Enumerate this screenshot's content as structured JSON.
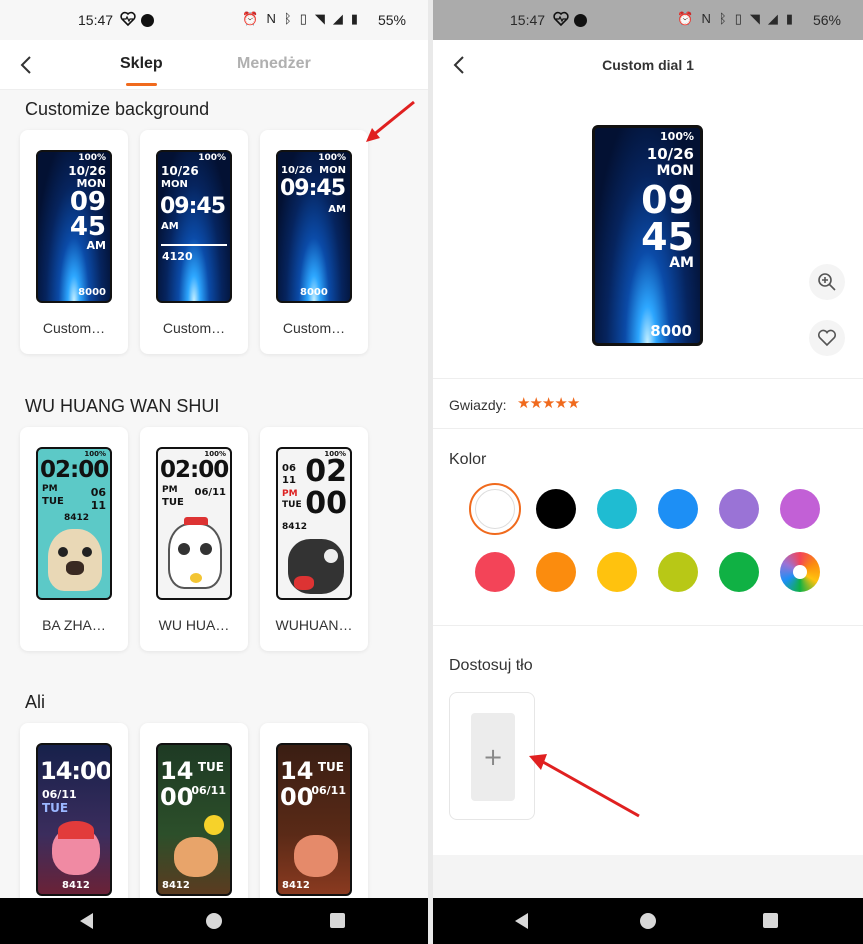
{
  "left": {
    "status": {
      "time": "15:47",
      "battery": "55%"
    },
    "tabs": {
      "active": "Sklep",
      "inactive": "Menedżer"
    },
    "sections": [
      {
        "title": "Customize background",
        "cards": [
          "Custom…",
          "Custom…",
          "Custom…"
        ]
      },
      {
        "title": "WU HUANG WAN SHUI",
        "cards": [
          "BA ZHA…",
          "WU HUA…",
          "WUHUAN…"
        ]
      },
      {
        "title": "Ali",
        "cards": [
          "",
          "",
          ""
        ]
      }
    ],
    "thumbs": {
      "c1": {
        "batt": "100%",
        "date": "10/26",
        "day": "MON",
        "h": "09",
        "m": "45",
        "ampm": "AM",
        "steps": "8000"
      },
      "c2": {
        "batt": "100%",
        "date": "10/26",
        "day": "MON",
        "time": "09:45",
        "ampm": "AM",
        "steps": "4120"
      },
      "c3": {
        "batt": "100%",
        "date": "10/26",
        "day": "MON",
        "time": "09:45",
        "ampm": "AM",
        "steps": "8000"
      },
      "w1": {
        "batt": "100%",
        "time": "02:00",
        "pm": "PM",
        "day": "TUE",
        "date1": "06",
        "date2": "11",
        "steps": "8412"
      },
      "w2": {
        "batt": "100%",
        "time": "02:00",
        "pm": "PM",
        "date": "06/11",
        "day": "TUE"
      },
      "w3": {
        "batt": "100%",
        "d1": "06",
        "d2": "11",
        "h": "02",
        "m": "00",
        "pm": "PM",
        "day": "TUE",
        "steps": "8412"
      },
      "a1": {
        "time": "14:00",
        "date": "06/11",
        "day": "TUE",
        "steps": "8412"
      },
      "a2": {
        "h": "14",
        "m": "00",
        "day": "TUE",
        "date": "06/11",
        "steps": "8412"
      },
      "a3": {
        "h": "14",
        "m": "00",
        "day": "TUE",
        "date": "06/11",
        "steps": "8412"
      }
    }
  },
  "right": {
    "status": {
      "time": "15:47",
      "battery": "56%"
    },
    "title": "Custom dial 1",
    "preview": {
      "batt": "100%",
      "date": "10/26",
      "day": "MON",
      "h": "09",
      "m": "45",
      "ampm": "AM",
      "steps": "8000"
    },
    "stars_label": "Gwiazdy:",
    "stars_value": 5,
    "color_label": "Kolor",
    "colors": [
      "#ffffff",
      "#000000",
      "#1fbcd2",
      "#1d8ff5",
      "#9a73d6",
      "#c260d6",
      "#f34458",
      "#fb8c0e",
      "#ffc20e",
      "#b8c816",
      "#10b144",
      "rainbow"
    ],
    "selected_color": "#ffffff",
    "custom_bg_label": "Dostosuj tło",
    "add_symbol": "+"
  },
  "icons": {
    "back": "chevron-left-icon",
    "zoom": "zoom-in-icon",
    "favorite": "heart-icon",
    "add": "plus-icon",
    "star": "star-icon"
  },
  "accent_color": "#f06a1d",
  "annotation_color": "#e02020"
}
